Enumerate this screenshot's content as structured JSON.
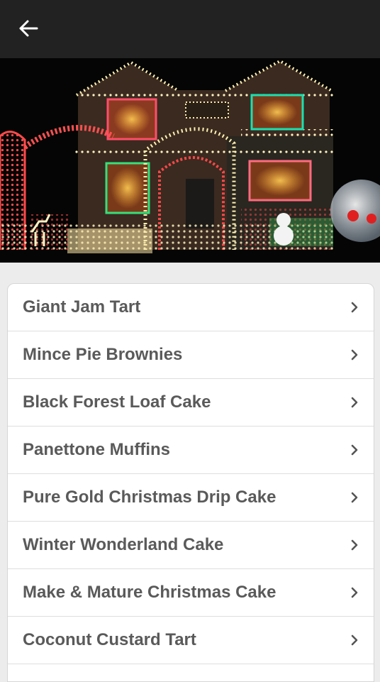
{
  "header": {
    "back_icon": "arrow-left-icon",
    "background": "#222222"
  },
  "hero": {
    "subject": "house decorated with christmas lights"
  },
  "recipes": [
    {
      "title": "Giant Jam Tart"
    },
    {
      "title": "Mince Pie Brownies"
    },
    {
      "title": "Black Forest Loaf Cake"
    },
    {
      "title": "Panettone Muffins"
    },
    {
      "title": "Pure Gold Christmas Drip Cake"
    },
    {
      "title": "Winter Wonderland Cake"
    },
    {
      "title": "Make & Mature Christmas Cake"
    },
    {
      "title": "Coconut Custard Tart"
    }
  ],
  "list_item_icon": "chevron-right-icon"
}
